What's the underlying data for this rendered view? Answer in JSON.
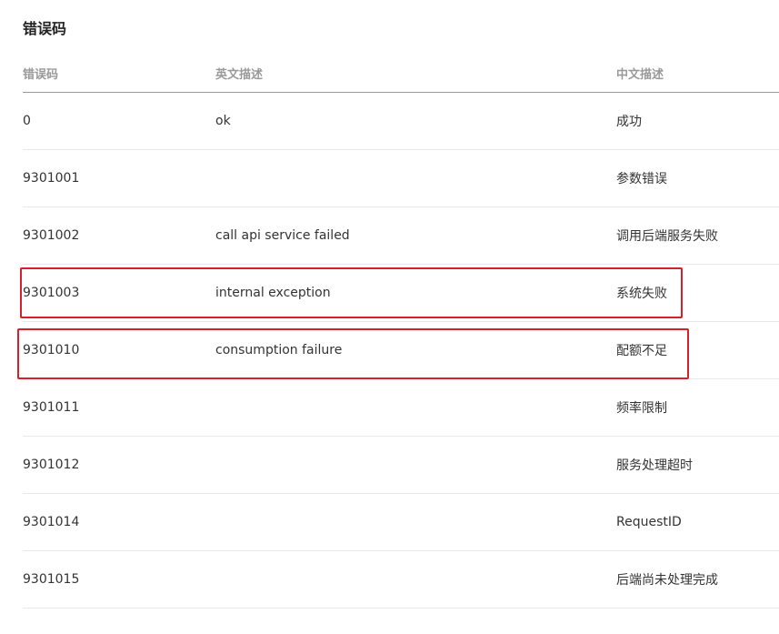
{
  "page": {
    "title": "错误码"
  },
  "table": {
    "headers": {
      "code": "错误码",
      "english": "英文描述",
      "chinese": "中文描述"
    },
    "rows": [
      {
        "code": "0",
        "english": "ok",
        "chinese": "成功"
      },
      {
        "code": "9301001",
        "english": "",
        "chinese": "参数错误"
      },
      {
        "code": "9301002",
        "english": "call api service failed",
        "chinese": "调用后端服务失败"
      },
      {
        "code": "9301003",
        "english": "internal exception",
        "chinese": "系统失败"
      },
      {
        "code": "9301010",
        "english": "consumption failure",
        "chinese": "配额不足"
      },
      {
        "code": "9301011",
        "english": "",
        "chinese": "频率限制"
      },
      {
        "code": "9301012",
        "english": "",
        "chinese": "服务处理超时"
      },
      {
        "code": "9301014",
        "english": "",
        "chinese": "RequestID"
      },
      {
        "code": "9301015",
        "english": "",
        "chinese": "后端尚未处理完成"
      }
    ]
  },
  "annotations": {
    "highlight_color": "#d6202a",
    "highlighted_codes": [
      "9301003",
      "9301010"
    ]
  }
}
